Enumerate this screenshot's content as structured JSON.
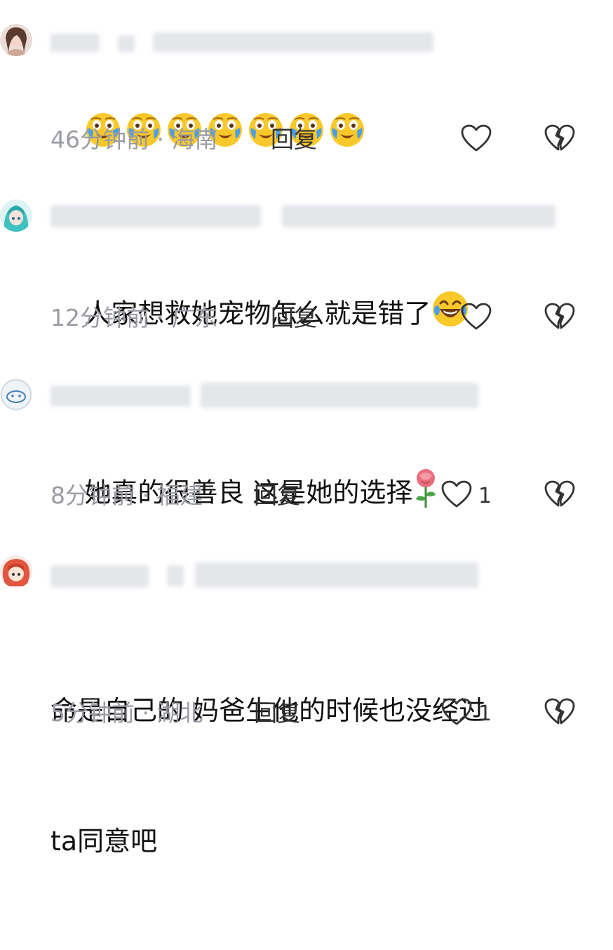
{
  "comments": [
    {
      "text": "",
      "emoji_count": 7,
      "time": "46分钟前",
      "separator": "·",
      "location": "海南",
      "reply_label": "回复",
      "like_count": ""
    },
    {
      "text": "人家想救她宠物怎么就是错了",
      "time": "12分钟前",
      "separator": "·",
      "location": "广东",
      "reply_label": "回复",
      "like_count": ""
    },
    {
      "text": "她真的很善良 这是她的选择",
      "time": "8分钟前",
      "separator": "·",
      "location": "福建",
      "reply_label": "回复",
      "like_count": "1"
    },
    {
      "text_line1": "命是自己的 妈爸生他的时候也没经过",
      "text_line2": "ta同意吧",
      "time": "5分钟前",
      "separator": "·",
      "location": "湖北",
      "reply_label": "回复",
      "like_count": "1"
    }
  ],
  "icons": {
    "like": "heart-outline-icon",
    "dislike": "broken-heart-icon",
    "emoji_cry_laugh": "crying-face-emoji",
    "emoji_rofl": "rofl-emoji",
    "emoji_rose": "rose-emoji"
  },
  "colors": {
    "meta_text": "#9a9ca3",
    "icon_stroke": "#333333",
    "emoji_yellow": "#f9c92b",
    "tear_blue": "#4a9fe8"
  }
}
